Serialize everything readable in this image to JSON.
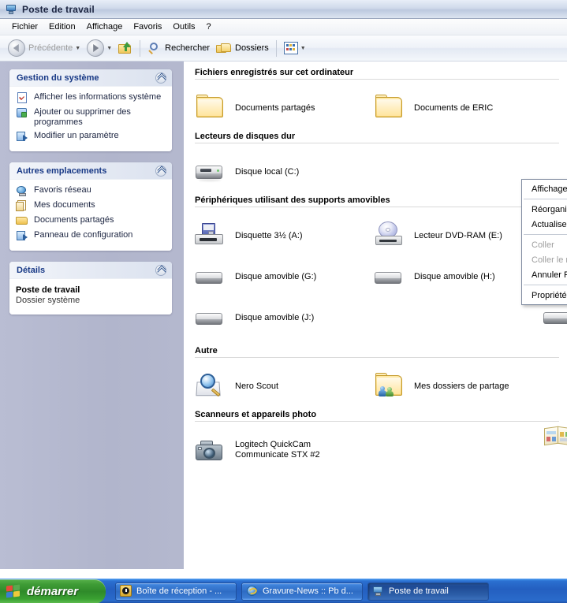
{
  "window": {
    "title": "Poste de travail",
    "title_icon": "my-computer-icon"
  },
  "menubar": {
    "items": [
      {
        "label": "Fichier"
      },
      {
        "label": "Edition"
      },
      {
        "label": "Affichage"
      },
      {
        "label": "Favoris"
      },
      {
        "label": "Outils"
      },
      {
        "label": "?"
      }
    ]
  },
  "toolbar": {
    "back_label": "Précédente",
    "forward_label": "",
    "up_label": "",
    "search_label": "Rechercher",
    "folders_label": "Dossiers",
    "views_label": ""
  },
  "sidebar": {
    "panels": [
      {
        "title": "Gestion du système",
        "collapse_icon": "chevron-up-icon",
        "items": [
          {
            "label": "Afficher les informations système",
            "icon": "system-info-icon"
          },
          {
            "label": "Ajouter ou supprimer des programmes",
            "icon": "add-remove-programs-icon"
          },
          {
            "label": "Modifier un paramètre",
            "icon": "change-setting-icon"
          }
        ]
      },
      {
        "title": "Autres emplacements",
        "collapse_icon": "chevron-up-icon",
        "items": [
          {
            "label": "Favoris réseau",
            "icon": "network-places-icon"
          },
          {
            "label": "Mes documents",
            "icon": "my-documents-icon"
          },
          {
            "label": "Documents partagés",
            "icon": "shared-documents-icon"
          },
          {
            "label": "Panneau de configuration",
            "icon": "control-panel-icon"
          }
        ]
      }
    ],
    "details": {
      "title": "Détails",
      "collapse_icon": "chevron-up-icon",
      "name": "Poste de travail",
      "type": "Dossier système"
    }
  },
  "content": {
    "sections": [
      {
        "heading": "Fichiers enregistrés sur cet ordinateur",
        "items": [
          {
            "label": "Documents partagés",
            "icon": "shared-folder-icon"
          },
          {
            "label": "Documents de ERIC",
            "icon": "folder-icon"
          }
        ]
      },
      {
        "heading": "Lecteurs de disques dur",
        "items": [
          {
            "label": "Disque local (C:)",
            "icon": "hard-disk-icon"
          }
        ]
      },
      {
        "heading": "Périphériques utilisant des supports amovibles",
        "items": [
          {
            "label": "Disquette 3½ (A:)",
            "icon": "floppy-drive-icon"
          },
          {
            "label": "Lecteur DVD-RAM (E:)",
            "icon": "dvd-drive-icon"
          },
          {
            "label": "Disque amovible (G:)",
            "icon": "removable-disk-icon"
          },
          {
            "label": "Disque amovible (H:)",
            "icon": "removable-disk-icon"
          },
          {
            "label": "",
            "icon": "removable-disk-icon"
          },
          {
            "label": "Disque amovible (J:)",
            "icon": "removable-disk-icon"
          }
        ]
      },
      {
        "heading": "Autre",
        "items": [
          {
            "label": "Nero Scout",
            "icon": "nero-scout-icon"
          },
          {
            "label": "Mes dossiers de partage",
            "icon": "shared-folders-icon"
          },
          {
            "label": "",
            "icon": "scanner-book-icon"
          }
        ]
      },
      {
        "heading": "Scanneurs et appareils photo",
        "items": [
          {
            "label": "Logitech QuickCam Communicate STX #2",
            "icon": "camera-icon"
          }
        ]
      }
    ]
  },
  "context_menu": {
    "items": [
      {
        "label": "Affichage",
        "disabled": false,
        "submenu": true
      },
      {
        "separator": true
      },
      {
        "label": "Réorganiser les icônes par",
        "disabled": false,
        "submenu": true
      },
      {
        "label": "Actualiser",
        "disabled": false
      },
      {
        "separator": true
      },
      {
        "label": "Coller",
        "disabled": true
      },
      {
        "label": "Coller le raccourci",
        "disabled": true
      },
      {
        "label": "Annuler Renommer",
        "disabled": false
      },
      {
        "separator": true
      },
      {
        "label": "Propriétés",
        "disabled": false
      }
    ]
  },
  "taskbar": {
    "start_label": "démarrer",
    "start_icon": "windows-flag-icon",
    "buttons": [
      {
        "label": "Boîte de réception - ...",
        "icon": "outlook-icon",
        "active": false
      },
      {
        "label": "Gravure-News :: Pb d...",
        "icon": "internet-explorer-icon",
        "active": false
      },
      {
        "label": "Poste de travail",
        "icon": "my-computer-icon",
        "active": true
      }
    ]
  },
  "colors": {
    "taskbar_blue": "#2a6fd0",
    "start_green": "#3f9c36",
    "sidebar_bg": "#b3b7ce",
    "panel_title": "#173885",
    "menu_highlight": "#316ac5"
  }
}
